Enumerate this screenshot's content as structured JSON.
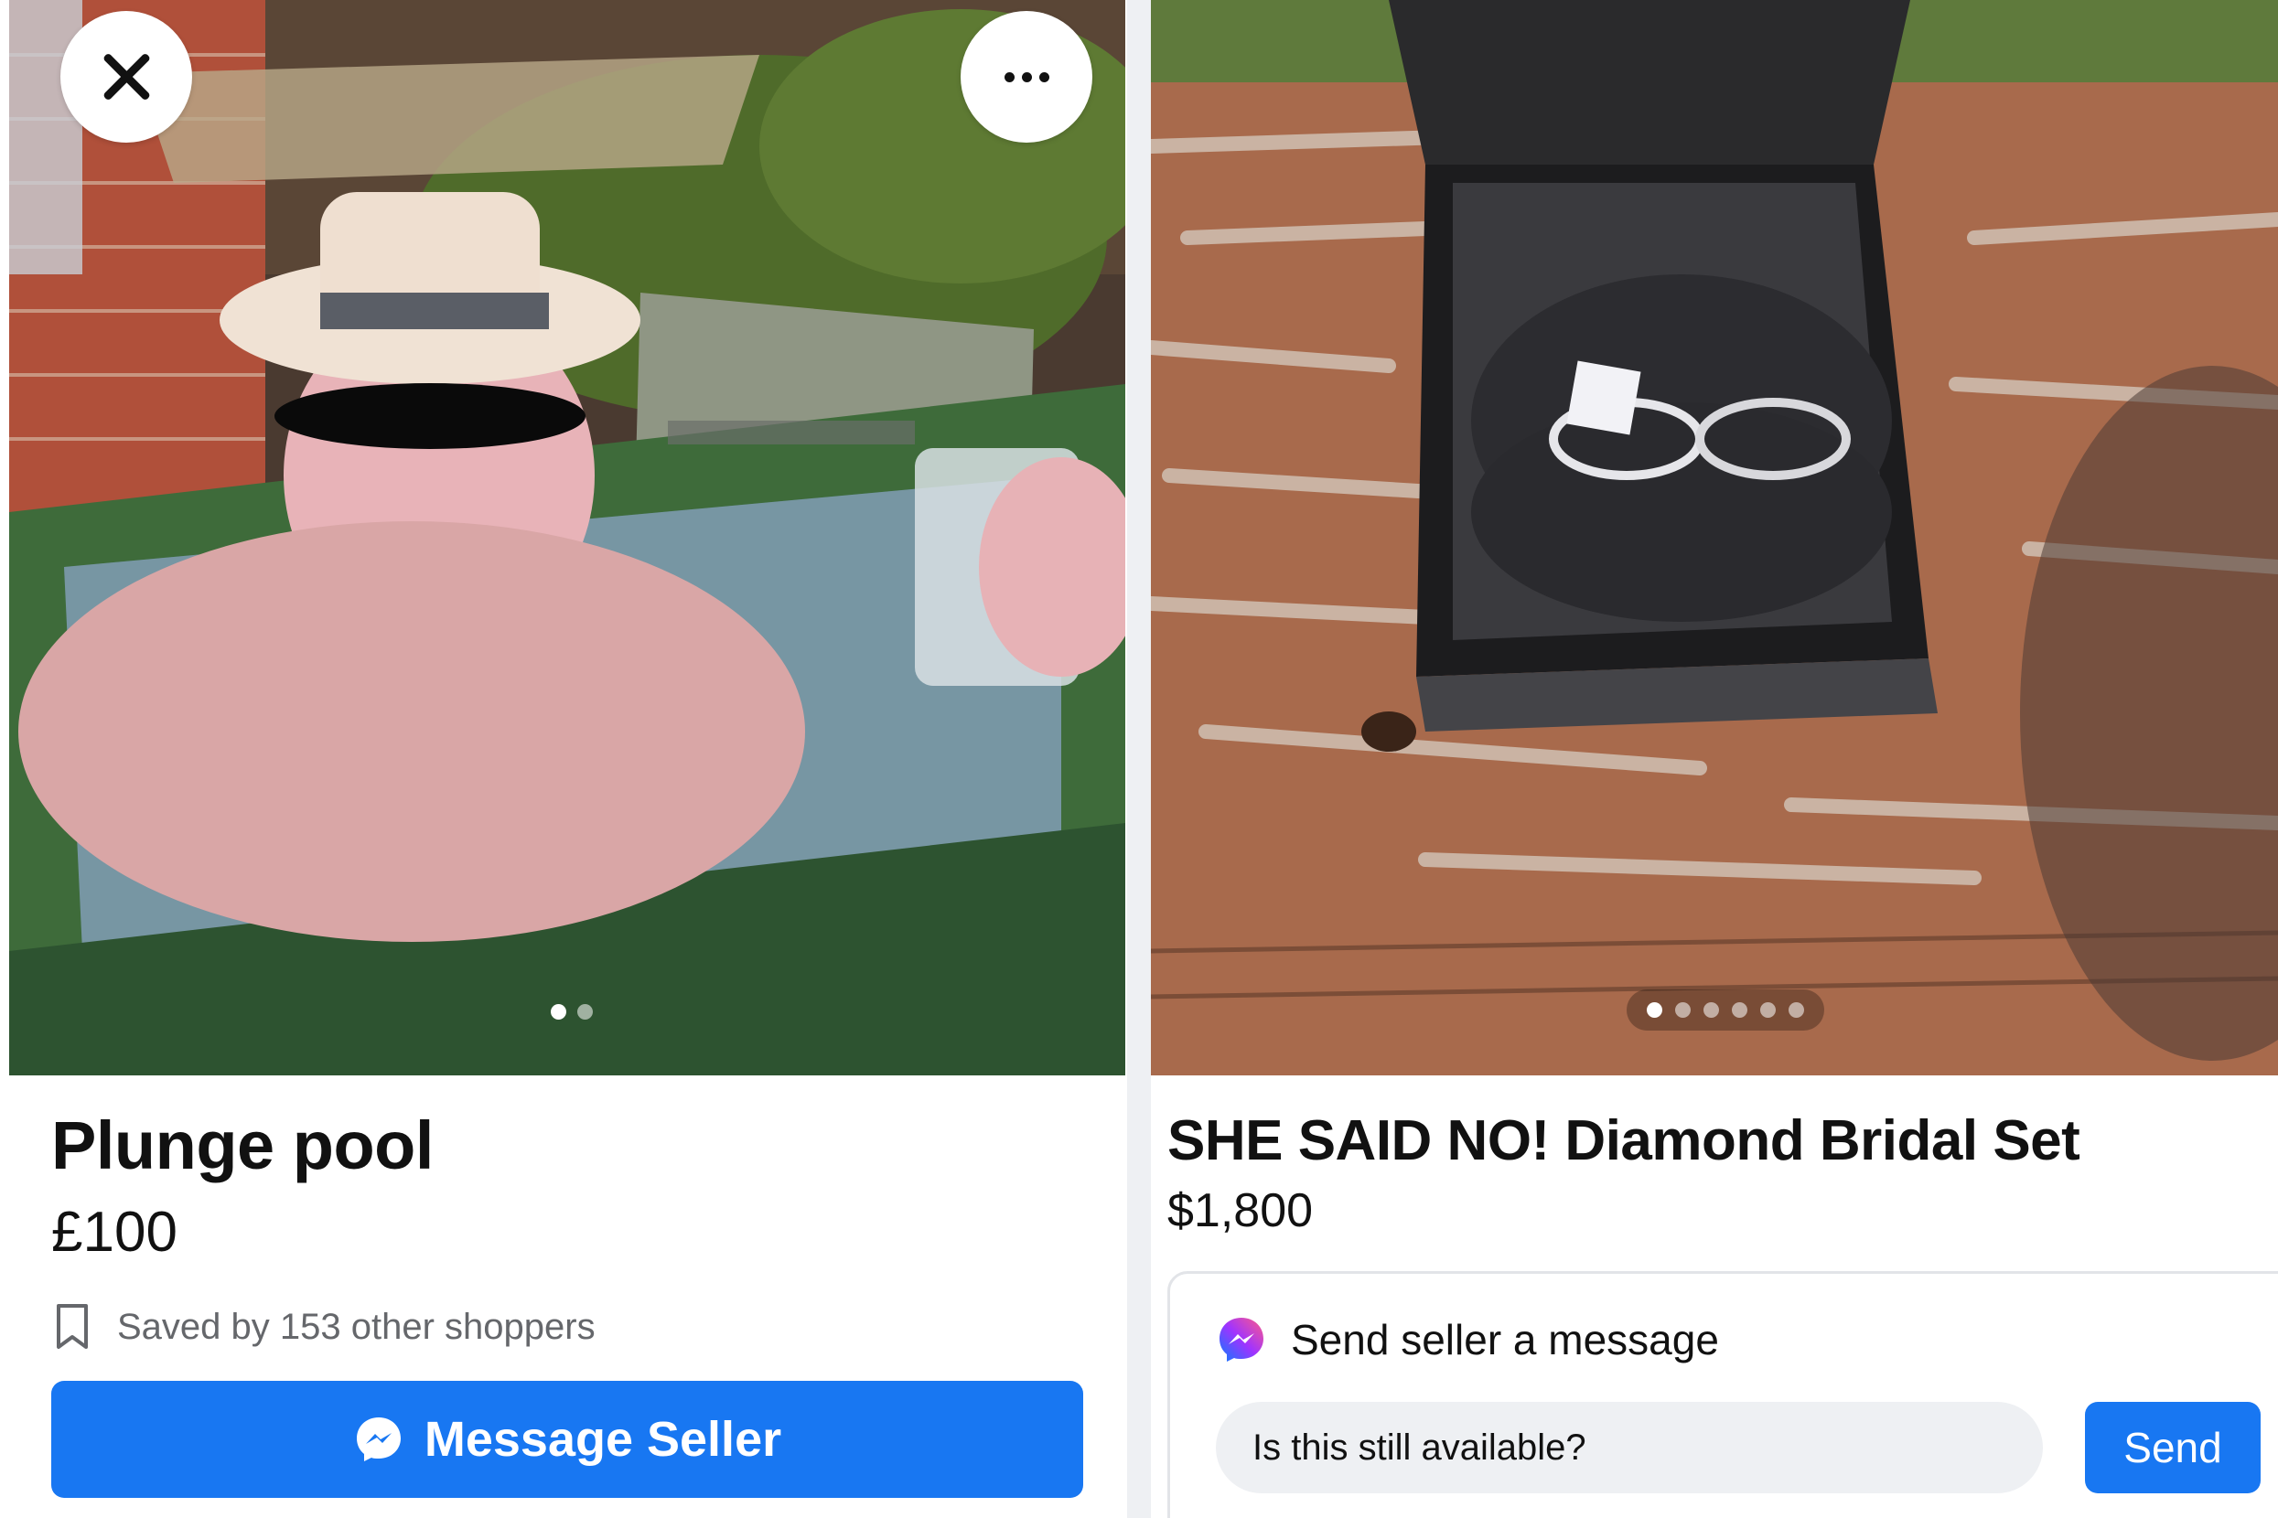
{
  "left_listing": {
    "title": "Plunge pool",
    "price": "£100",
    "saved_text": "Saved by 153 other shoppers",
    "message_button": "Message Seller",
    "photo_pager": {
      "count": 2,
      "active": 0
    },
    "icons": {
      "close": "close-icon",
      "more": "more-options-icon",
      "bookmark": "bookmark-icon",
      "messenger": "messenger-icon"
    }
  },
  "right_listing": {
    "title": "SHE SAID NO! Diamond Bridal Set",
    "price": "$1,800",
    "message_card": {
      "heading": "Send seller a message",
      "input_value": "Is this still available?",
      "send_label": "Send"
    },
    "photo_pager": {
      "count": 6,
      "active": 0
    },
    "icons": {
      "messenger": "messenger-icon"
    }
  },
  "colors": {
    "accent": "#1877f2",
    "secondary_text": "#65676b",
    "input_bg": "#eef0f3"
  }
}
